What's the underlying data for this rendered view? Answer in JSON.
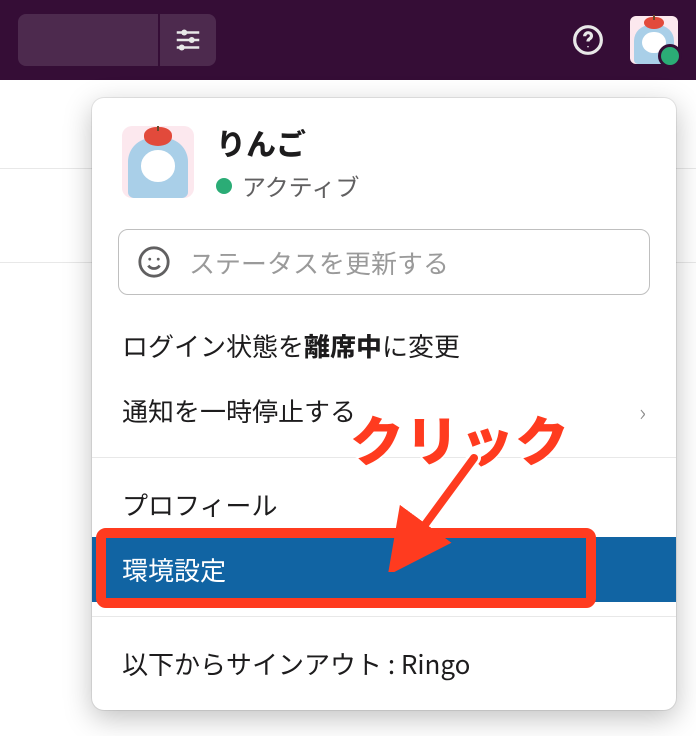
{
  "user": {
    "name": "りんご",
    "status_label": "アクティブ",
    "presence_color": "#2bac76"
  },
  "status_input": {
    "placeholder": "ステータスを更新する"
  },
  "menu": {
    "set_away_prefix": "ログイン状態を",
    "set_away_bold": "離席中",
    "set_away_suffix": "に変更",
    "pause_notifications": "通知を一時停止する",
    "profile": "プロフィール",
    "preferences": "環境設定",
    "signout": "以下からサインアウト : Ringo"
  },
  "annotation": {
    "label": "クリック"
  }
}
